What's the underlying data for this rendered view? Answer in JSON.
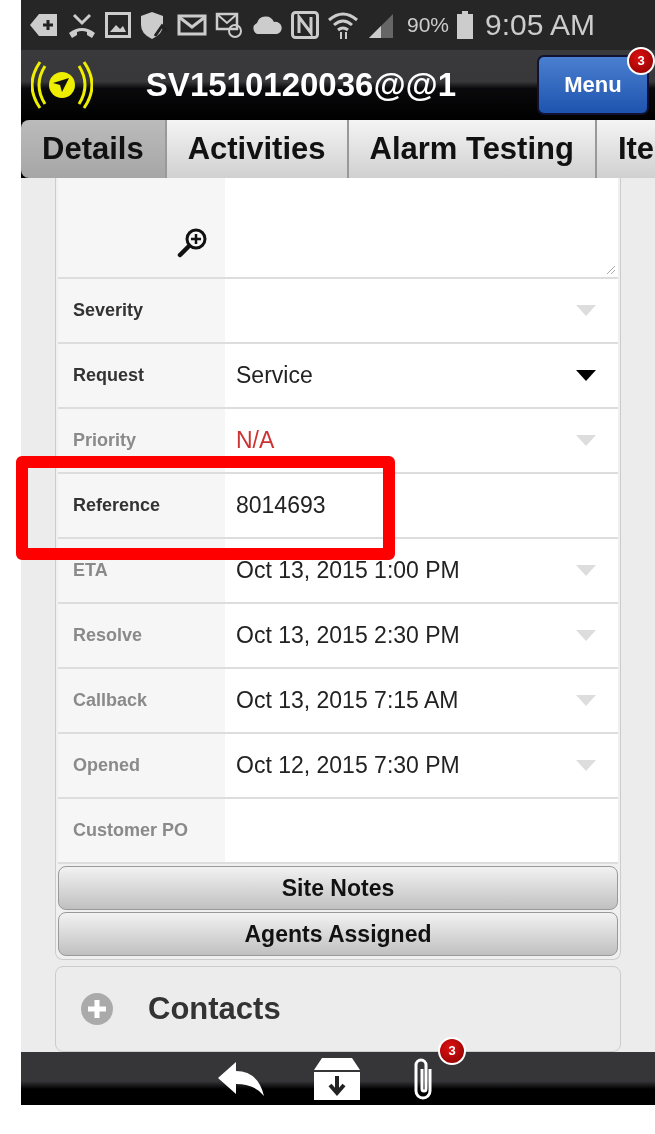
{
  "status_bar": {
    "battery": "90%",
    "time": "9:05 AM"
  },
  "header": {
    "title": "SV1510120036@@1",
    "menu_button": "Menu",
    "menu_badge": "3"
  },
  "tabs": [
    {
      "label": "Details",
      "selected": true
    },
    {
      "label": "Activities",
      "selected": false
    },
    {
      "label": "Alarm Testing",
      "selected": false
    },
    {
      "label": "Ite",
      "selected": false
    }
  ],
  "form": {
    "rows": [
      {
        "kind": "textarea"
      },
      {
        "kind": "select",
        "label": "Severity",
        "muted": false,
        "disabled": true
      },
      {
        "kind": "select",
        "label": "Request",
        "value": "Service",
        "muted": false,
        "disabled": false
      },
      {
        "kind": "select",
        "label": "Priority",
        "value": "N/A",
        "muted": true,
        "disabled": true,
        "alert": true
      },
      {
        "kind": "text",
        "label": "Reference",
        "value": "8014693",
        "muted": false
      },
      {
        "kind": "select",
        "label": "ETA",
        "value": "Oct 13, 2015 1:00 PM",
        "muted": true,
        "disabled": true
      },
      {
        "kind": "select",
        "label": "Resolve",
        "value": "Oct 13, 2015 2:30 PM",
        "muted": true,
        "disabled": true
      },
      {
        "kind": "select",
        "label": "Callback",
        "value": "Oct 13, 2015 7:15 AM",
        "muted": true,
        "disabled": true
      },
      {
        "kind": "select",
        "label": "Opened",
        "value": "Oct 12, 2015 7:30 PM",
        "muted": true,
        "disabled": true
      },
      {
        "kind": "text",
        "label": "Customer PO",
        "muted": true
      }
    ],
    "buttons": [
      "Site Notes",
      "Agents Assigned"
    ]
  },
  "sections": [
    {
      "title": "Contacts",
      "expanded": false
    }
  ],
  "bottom_bar": {
    "attachments_badge": "3"
  }
}
